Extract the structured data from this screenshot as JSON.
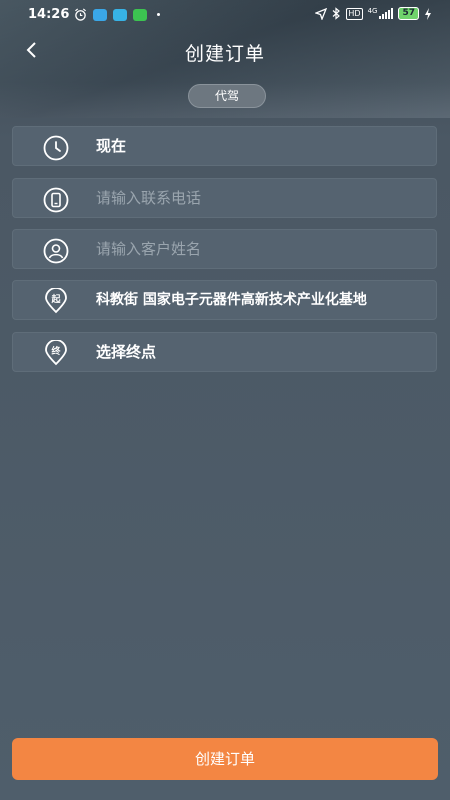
{
  "status_bar": {
    "time": "14:26",
    "icons_left": [
      "alarm-icon",
      "car-app-icon",
      "telegram-icon",
      "wechat-icon",
      "dot-icon"
    ],
    "icons_right": [
      "location-icon",
      "bluetooth-icon",
      "hd-icon",
      "signal-icon",
      "battery-icon",
      "charging-icon"
    ],
    "hd_label": "HD",
    "network_label": "4G",
    "battery_level": "57"
  },
  "header": {
    "title": "创建订单",
    "mode_label": "代驾"
  },
  "form": {
    "time_value": "现在",
    "phone_placeholder": "请输入联系电话",
    "name_placeholder": "请输入客户姓名",
    "start_badge": "起",
    "start_address": "科教街  国家电子元器件高新技术产业化基地",
    "end_badge": "终",
    "end_label": "选择终点"
  },
  "footer": {
    "submit_label": "创建订单"
  },
  "colors": {
    "accent": "#f38643",
    "row_bg": "#556370",
    "background": "#4f5e6b"
  }
}
